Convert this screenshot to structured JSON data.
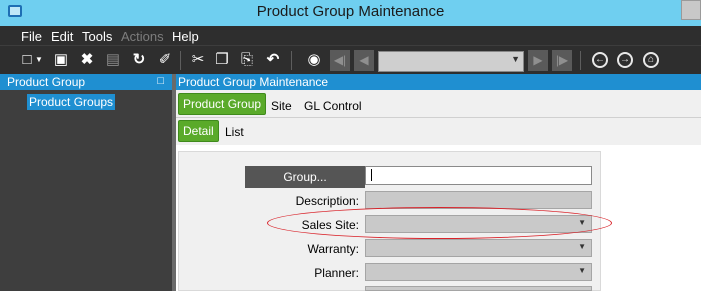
{
  "window": {
    "title": "Product Group Maintenance"
  },
  "menu": [
    {
      "label": "File",
      "enabled": true
    },
    {
      "label": "Edit",
      "enabled": true
    },
    {
      "label": "Tools",
      "enabled": true
    },
    {
      "label": "Actions",
      "enabled": false
    },
    {
      "label": "Help",
      "enabled": true
    }
  ],
  "toolbar": {
    "icons": [
      "new-icon",
      "dropdown-icon",
      "save-icon",
      "delete-icon",
      "open-book-icon",
      "refresh-icon",
      "clear-icon",
      "cut-icon",
      "copy-icon",
      "paste-icon",
      "undo-icon",
      "binoculars-icon",
      "first-icon",
      "previous-icon",
      "next-icon",
      "last-icon",
      "back-icon",
      "forward-icon",
      "home-icon"
    ],
    "nav_combo_value": ""
  },
  "left_panel": {
    "header": "Product Group",
    "tree_items": [
      "Product Groups"
    ]
  },
  "main": {
    "header": "Product Group Maintenance",
    "tabs": [
      "Product Group",
      "Site",
      "GL Control"
    ],
    "active_tab": "Product Group",
    "subtabs": [
      "Detail",
      "List"
    ],
    "active_subtab": "Detail"
  },
  "form": {
    "group_button": "Group...",
    "group_value": "",
    "description_label": "Description:",
    "description_value": "",
    "sales_site_label": "Sales Site:",
    "sales_site_value": "",
    "warranty_label": "Warranty:",
    "warranty_value": "",
    "planner_label": "Planner:",
    "planner_value": ""
  },
  "colors": {
    "titlebar": "#6fcff0",
    "dark_chrome": "#2e2e2e",
    "selection_blue": "#1f8fd1",
    "active_tab_green": "#5aaa2a",
    "annotation_red": "#d9232a"
  }
}
